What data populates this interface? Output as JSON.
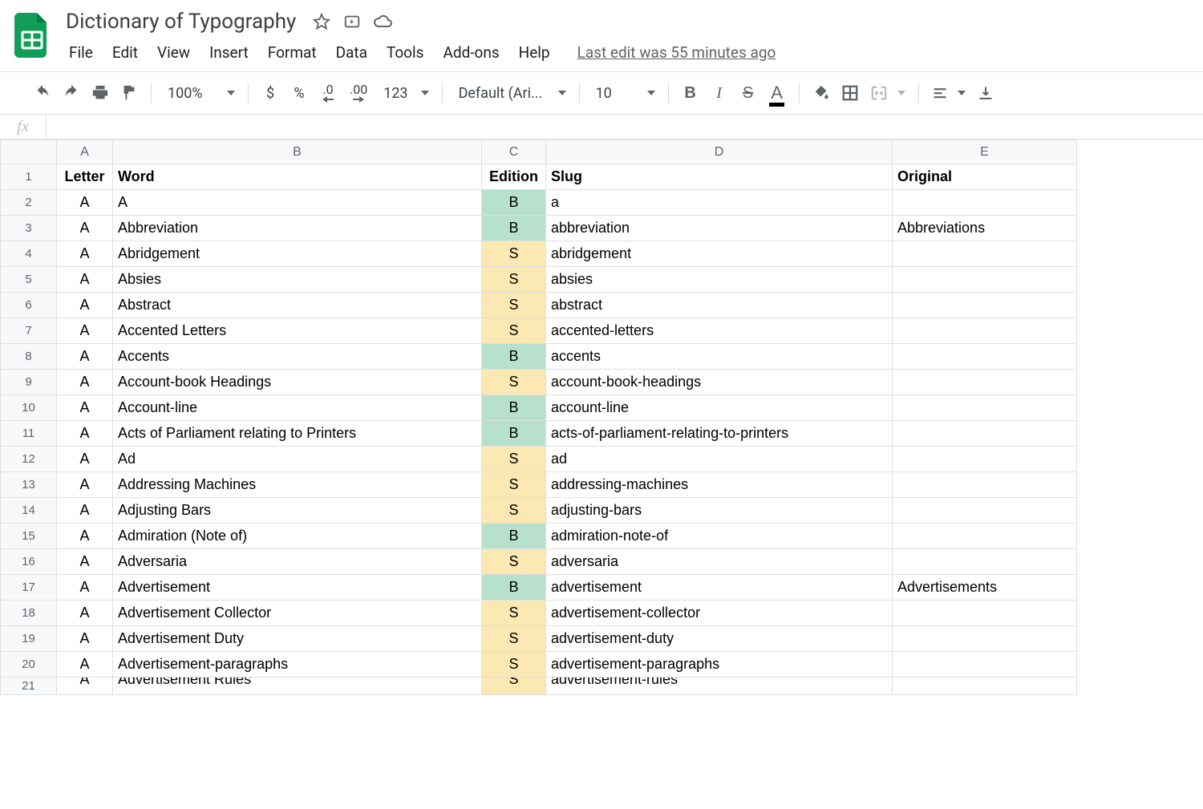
{
  "doc": {
    "title": "Dictionary of Typography",
    "last_edit": "Last edit was 55 minutes ago"
  },
  "menus": [
    "File",
    "Edit",
    "View",
    "Insert",
    "Format",
    "Data",
    "Tools",
    "Add-ons",
    "Help"
  ],
  "toolbar": {
    "zoom": "100%",
    "font": "Default (Ari...",
    "font_size": "10",
    "number_123": "123",
    "decimal_dec": ".0",
    "decimal_inc": ".00",
    "dollar": "$",
    "percent": "%"
  },
  "formula_bar": {
    "fx": "fx",
    "value": ""
  },
  "columns": [
    "A",
    "B",
    "C",
    "D",
    "E"
  ],
  "headers": {
    "A": "Letter",
    "B": "Word",
    "C": "Edition",
    "D": "Slug",
    "E": "Original"
  },
  "rows": [
    {
      "n": 2,
      "letter": "A",
      "word": "A",
      "edition": "B",
      "slug": "a",
      "original": ""
    },
    {
      "n": 3,
      "letter": "A",
      "word": "Abbreviation",
      "edition": "B",
      "slug": "abbreviation",
      "original": "Abbreviations"
    },
    {
      "n": 4,
      "letter": "A",
      "word": "Abridgement",
      "edition": "S",
      "slug": "abridgement",
      "original": ""
    },
    {
      "n": 5,
      "letter": "A",
      "word": "Absies",
      "edition": "S",
      "slug": "absies",
      "original": ""
    },
    {
      "n": 6,
      "letter": "A",
      "word": "Abstract",
      "edition": "S",
      "slug": "abstract",
      "original": ""
    },
    {
      "n": 7,
      "letter": "A",
      "word": "Accented Letters",
      "edition": "S",
      "slug": "accented-letters",
      "original": ""
    },
    {
      "n": 8,
      "letter": "A",
      "word": "Accents",
      "edition": "B",
      "slug": "accents",
      "original": ""
    },
    {
      "n": 9,
      "letter": "A",
      "word": "Account-book Headings",
      "edition": "S",
      "slug": "account-book-headings",
      "original": ""
    },
    {
      "n": 10,
      "letter": "A",
      "word": "Account-line",
      "edition": "B",
      "slug": "account-line",
      "original": ""
    },
    {
      "n": 11,
      "letter": "A",
      "word": "Acts of Parliament relating to Printers",
      "edition": "B",
      "slug": "acts-of-parliament-relating-to-printers",
      "original": ""
    },
    {
      "n": 12,
      "letter": "A",
      "word": "Ad",
      "edition": "S",
      "slug": "ad",
      "original": ""
    },
    {
      "n": 13,
      "letter": "A",
      "word": "Addressing Machines",
      "edition": "S",
      "slug": "addressing-machines",
      "original": ""
    },
    {
      "n": 14,
      "letter": "A",
      "word": "Adjusting Bars",
      "edition": "S",
      "slug": "adjusting-bars",
      "original": ""
    },
    {
      "n": 15,
      "letter": "A",
      "word": "Admiration (Note of)",
      "edition": "B",
      "slug": "admiration-note-of",
      "original": ""
    },
    {
      "n": 16,
      "letter": "A",
      "word": "Adversaria",
      "edition": "S",
      "slug": "adversaria",
      "original": ""
    },
    {
      "n": 17,
      "letter": "A",
      "word": "Advertisement",
      "edition": "B",
      "slug": "advertisement",
      "original": "Advertisements"
    },
    {
      "n": 18,
      "letter": "A",
      "word": "Advertisement Collector",
      "edition": "S",
      "slug": "advertisement-collector",
      "original": ""
    },
    {
      "n": 19,
      "letter": "A",
      "word": "Advertisement Duty",
      "edition": "S",
      "slug": "advertisement-duty",
      "original": ""
    },
    {
      "n": 20,
      "letter": "A",
      "word": "Advertisement-paragraphs",
      "edition": "S",
      "slug": "advertisement-paragraphs",
      "original": ""
    },
    {
      "n": 21,
      "letter": "A",
      "word": "Advertisement Rules",
      "edition": "S",
      "slug": "advertisement-rules",
      "original": ""
    }
  ]
}
